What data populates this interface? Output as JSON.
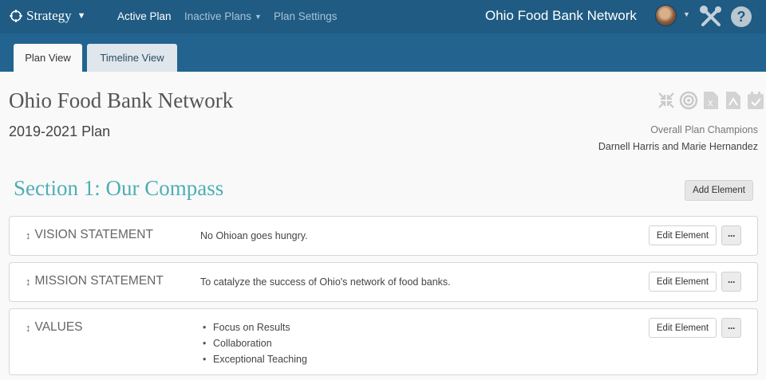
{
  "topbar": {
    "brand": "Strategy",
    "nav": {
      "active_plan": "Active Plan",
      "inactive_plans": "Inactive Plans",
      "plan_settings": "Plan Settings"
    },
    "org_title": "Ohio Food Bank Network",
    "help": "?"
  },
  "tabs": {
    "plan_view": "Plan View",
    "timeline_view": "Timeline View"
  },
  "header": {
    "org": "Ohio Food Bank Network",
    "plan": "2019-2021 Plan",
    "champions_label": "Overall Plan Champions",
    "champions_names": "Darnell Harris and Marie Hernandez",
    "icons": [
      "collapse-icon",
      "target-icon",
      "excel-icon",
      "pdf-icon",
      "calendar-check-icon"
    ]
  },
  "section": {
    "title": "Section 1: Our Compass",
    "add_element": "Add Element"
  },
  "elements": [
    {
      "label": "VISION STATEMENT",
      "content": "No Ohioan goes hungry.",
      "edit": "Edit Element",
      "more": "···"
    },
    {
      "label": "MISSION STATEMENT",
      "content": "To catalyze the success of Ohio's network of food banks.",
      "edit": "Edit Element",
      "more": "···"
    },
    {
      "label": "VALUES",
      "items": [
        "Focus on Results",
        "Collaboration",
        "Exceptional Teaching"
      ],
      "edit": "Edit Element",
      "more": "···"
    }
  ],
  "colors": {
    "navbar": "#1f5b83",
    "tabstrip": "#22648f",
    "section_title": "#4eaeb4"
  }
}
